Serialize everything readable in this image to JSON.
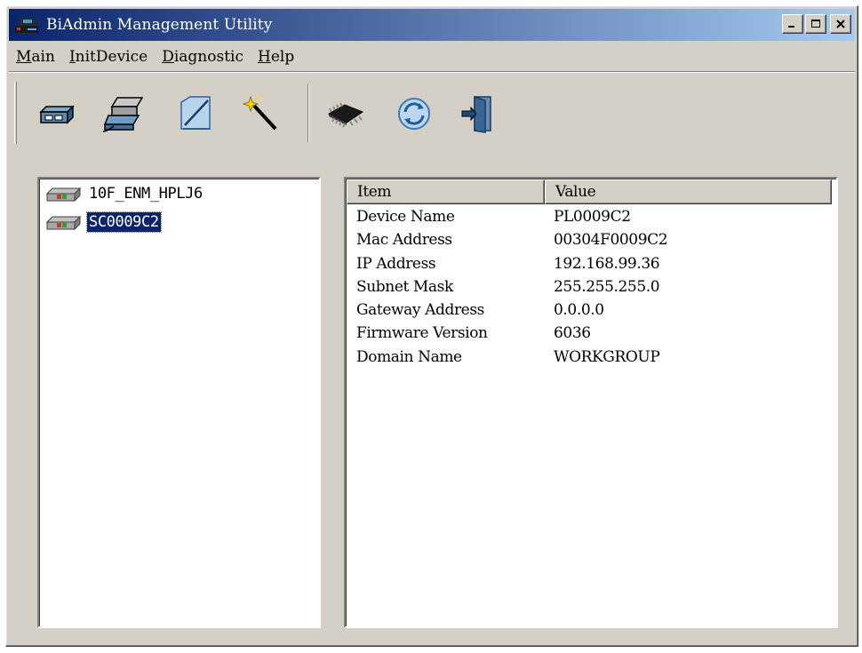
{
  "window": {
    "title": "BiAdmin Management Utility",
    "controls": [
      "minimize",
      "maximize",
      "close"
    ]
  },
  "menu": [
    {
      "label": "Main",
      "accel": "M",
      "rest": "ain"
    },
    {
      "label": "InitDevice",
      "accel": "I",
      "rest": "nitDevice"
    },
    {
      "label": "Diagnostic",
      "accel": "D",
      "rest": "iagnostic"
    },
    {
      "label": "Help",
      "accel": "H",
      "rest": "elp"
    }
  ],
  "toolbar": {
    "buttons": [
      {
        "icon": "network-device-icon"
      },
      {
        "icon": "printer-server-icon"
      },
      {
        "icon": "edit-pencil-icon"
      },
      {
        "icon": "magic-wand-icon"
      },
      {
        "icon": "memory-chip-icon"
      },
      {
        "icon": "refresh-icon"
      },
      {
        "icon": "exit-door-icon"
      }
    ]
  },
  "tree": {
    "items": [
      {
        "label": "10F_ENM_HPLJ6",
        "selected": false
      },
      {
        "label": "SC0009C2",
        "selected": true
      }
    ]
  },
  "details": {
    "columns": {
      "item": "Item",
      "value": "Value"
    },
    "rows": [
      {
        "item": "Device Name",
        "value": "PL0009C2"
      },
      {
        "item": "Mac Address",
        "value": "00304F0009C2"
      },
      {
        "item": "IP Address",
        "value": "192.168.99.36"
      },
      {
        "item": "Subnet Mask",
        "value": "255.255.255.0"
      },
      {
        "item": "Gateway Address",
        "value": "0.0.0.0"
      },
      {
        "item": "Firmware Version",
        "value": "6036"
      },
      {
        "item": "Domain Name",
        "value": "WORKGROUP"
      }
    ]
  },
  "colors": {
    "title_bar_start": "#0a246a",
    "title_bar_end": "#a6caf0",
    "face": "#d4d0c8",
    "selection": "#0a246a"
  }
}
